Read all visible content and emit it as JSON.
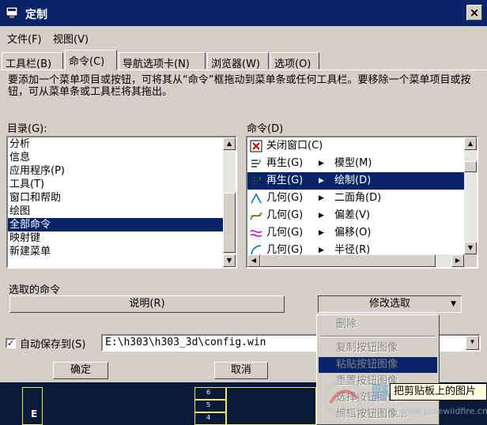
{
  "window": {
    "title": "定制",
    "close_glyph": "×"
  },
  "menu": {
    "file": "文件(F)",
    "view": "视图(V)"
  },
  "tabs": [
    "工具栏(B)",
    "命令(C)",
    "导航选项卡(N)",
    "浏览器(W)",
    "选项(O)"
  ],
  "active_tab": 1,
  "hint": "要添加一个菜单项目或按钮，可将其从“命令”框拖动到菜单条或任何工具栏。要移除一个菜单项目或按钮，可从菜单条或工具栏将其拖出。",
  "categories": {
    "label": "目录(G):",
    "items": [
      "分析",
      "信息",
      "应用程序(P)",
      "工具(T)",
      "窗口和帮助",
      "绘图",
      "全部命令",
      "映射键",
      "新建菜单"
    ],
    "selected_index": 6
  },
  "commands": {
    "label": "命令(D)",
    "items": [
      {
        "text": "关闭窗口(C)",
        "sub": "",
        "icon": "close-window-icon"
      },
      {
        "text": "再生(G)",
        "sub": "模型(M)",
        "icon": "regenerate-icon"
      },
      {
        "text": "再生(G)",
        "sub": "绘制(D)",
        "icon": "regenerate-icon"
      },
      {
        "text": "几何(G)",
        "sub": "二面角(D)",
        "icon": "dihedral-angle-icon"
      },
      {
        "text": "几何(G)",
        "sub": "偏差(V)",
        "icon": "deviation-icon"
      },
      {
        "text": "几何(G)",
        "sub": "偏移(O)",
        "icon": "offset-icon"
      },
      {
        "text": "几何(G)",
        "sub": "半径(R)",
        "icon": "radius-icon"
      }
    ],
    "selected_index": 2
  },
  "selected_command": {
    "label": "选取的命令",
    "describe_button": "说明(R)",
    "modify_button": "修改选取"
  },
  "modify_menu": [
    "删除",
    "复制按钮图像",
    "粘贴按钮图像",
    "重置按钮图像",
    "选择按钮图像...",
    "编辑按钮图像..."
  ],
  "modify_menu_highlight": 2,
  "autosave": {
    "label": "自动保存到(S)",
    "checked": true,
    "path": "E:\\h303\\h303_3d\\config.win"
  },
  "ok_button": "确定",
  "cancel_button": "取消",
  "tooltip": "把剪贴板上的图片",
  "drawing": {
    "row_labels": [
      "6",
      "5",
      "4"
    ],
    "zone_letter": "E"
  },
  "watermark": {
    "text": "野火论坛",
    "url": "www.proewildfire.cn"
  }
}
